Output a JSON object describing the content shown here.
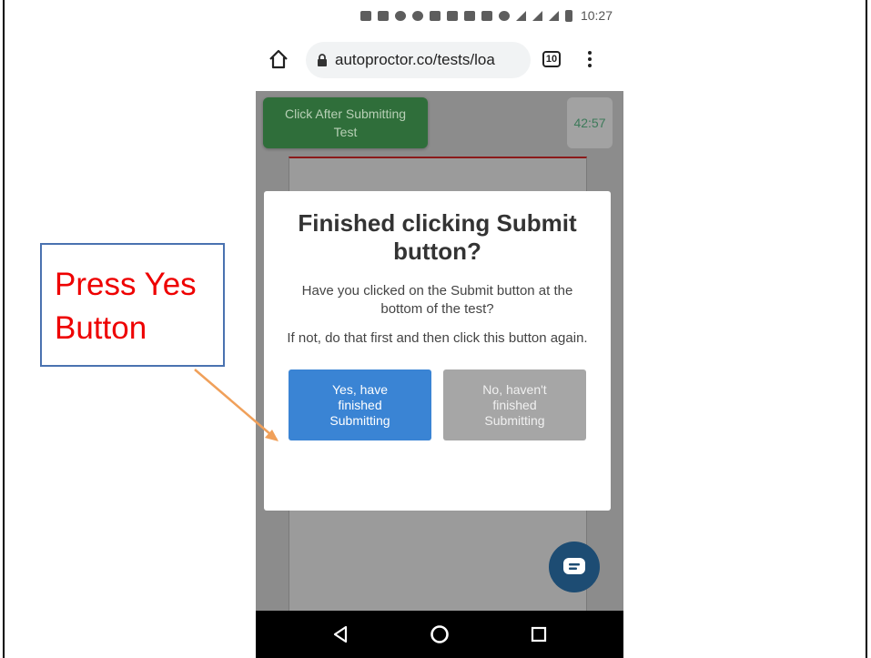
{
  "status_bar": {
    "time": "10:27"
  },
  "browser": {
    "url": "autoproctor.co/tests/loa",
    "tab_count": "10"
  },
  "page": {
    "submit_button_label": "Click After Submitting Test",
    "timer": "42:57"
  },
  "dialog": {
    "title": "Finished clicking Submit button?",
    "body1": "Have you clicked on the Submit button at the bottom of the test?",
    "body2": "If not, do that first and then click this button again.",
    "yes_label": "Yes, have finished Submitting",
    "no_label": "No, haven't finished Submitting"
  },
  "annotation": {
    "line1": "Press Yes",
    "line2": "Button",
    "arrow_color": "#f0a05a"
  },
  "colors": {
    "yes_button": "#3a84d4",
    "no_button": "#a6a6a6",
    "submit_button": "#2f6e3a",
    "chat_fab": "#1d4c73"
  },
  "icons": [
    "home-icon",
    "lock-icon",
    "tabs-icon",
    "menu-icon",
    "chat-icon",
    "back-icon",
    "home-nav-icon",
    "recents-icon"
  ]
}
